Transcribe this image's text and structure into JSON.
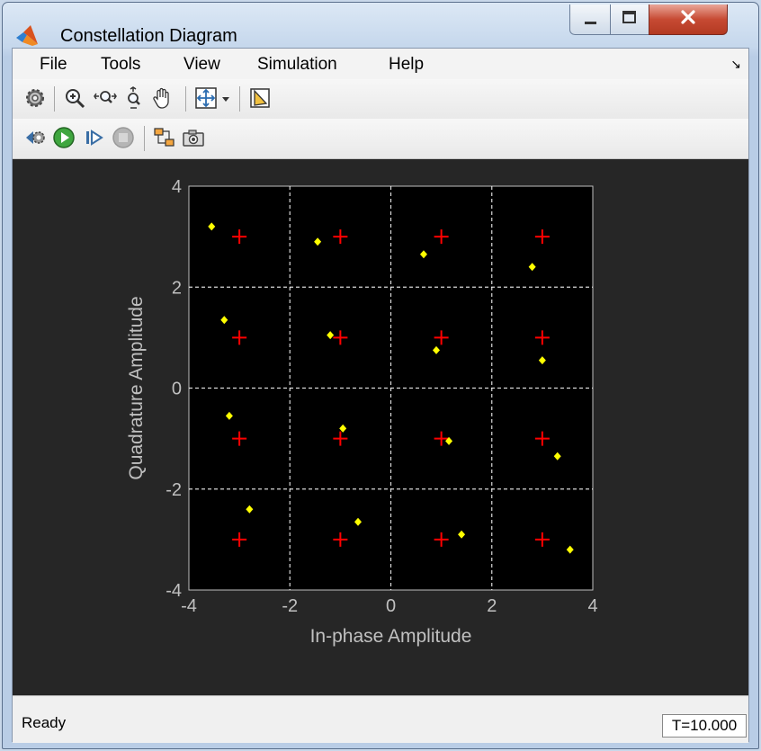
{
  "window": {
    "title": "Constellation Diagram"
  },
  "menu": [
    "File",
    "Tools",
    "View",
    "Simulation",
    "Help"
  ],
  "toolbar1": [
    "settings-icon",
    "zoom-in-icon",
    "zoom-x-icon",
    "zoom-y-icon",
    "pan-icon",
    "autoscale-icon",
    "dropdown-arrow-icon",
    "highlight-simulink-block-icon"
  ],
  "toolbar2": [
    "step-back-icon",
    "run-icon",
    "step-forward-icon",
    "stop-icon",
    "highlight-block-icon",
    "snapshot-icon"
  ],
  "colors": {
    "background": "#262626",
    "axes_background": "#000000",
    "reference_marker": "#ff0000",
    "signal_point": "#ffff00",
    "grid": "#ffffff",
    "axis_text": "#c0c0c0"
  },
  "status": {
    "text": "Ready",
    "time": "T=10.000"
  },
  "chart_data": {
    "type": "scatter",
    "xlabel": "In-phase Amplitude",
    "ylabel": "Quadrature Amplitude",
    "xlim": [
      -4,
      4
    ],
    "ylim": [
      -4,
      4
    ],
    "xticks": [
      "-4",
      "-2",
      "0",
      "2",
      "4"
    ],
    "yticks": [
      "-4",
      "-2",
      "0",
      "2",
      "4"
    ],
    "grid": true,
    "series": [
      {
        "marker": "plus",
        "color": "#ff0000",
        "x": [
          -3,
          -1,
          1,
          3,
          -3,
          -1,
          1,
          3,
          -3,
          -1,
          1,
          3,
          -3,
          -1,
          1,
          3
        ],
        "y": [
          3,
          3,
          3,
          3,
          1,
          1,
          1,
          1,
          -1,
          -1,
          -1,
          -1,
          -3,
          -3,
          -3,
          -3
        ]
      },
      {
        "marker": "diamond",
        "color": "#ffff00",
        "x": [
          -3.55,
          -1.45,
          0.65,
          2.8,
          -3.3,
          -1.2,
          0.9,
          3.0,
          -3.2,
          -0.95,
          1.15,
          3.3,
          -2.8,
          -0.65,
          1.4,
          3.55
        ],
        "y": [
          3.2,
          2.9,
          2.65,
          2.4,
          1.35,
          1.05,
          0.75,
          0.55,
          -0.55,
          -0.8,
          -1.05,
          -1.35,
          -2.4,
          -2.65,
          -2.9,
          -3.2
        ]
      }
    ]
  }
}
